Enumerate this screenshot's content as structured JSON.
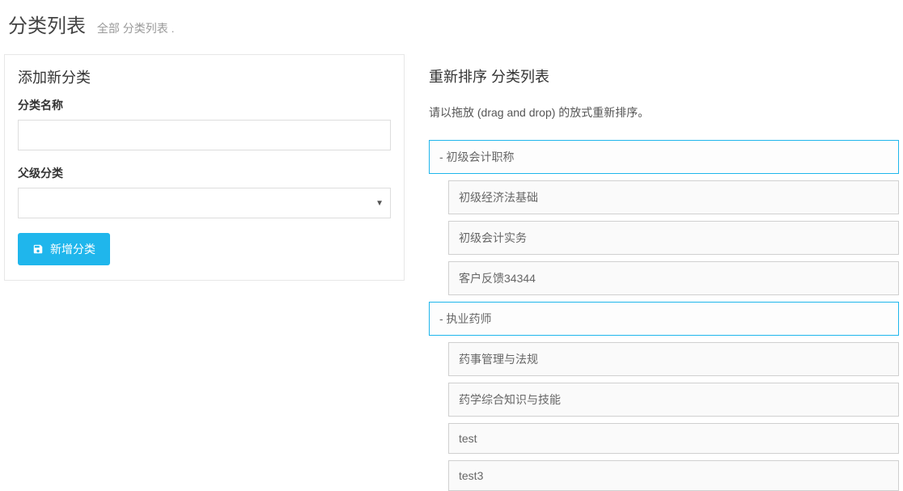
{
  "header": {
    "title": "分类列表",
    "subtitle": "全部 分类列表 ."
  },
  "form": {
    "panel_title": "添加新分类",
    "name_label": "分类名称",
    "name_value": "",
    "parent_label": "父级分类",
    "parent_value": "",
    "submit_label": "新增分类"
  },
  "reorder": {
    "title": "重新排序 分类列表",
    "hint": "请以拖放 (drag and drop) 的放式重新排序。",
    "items": [
      {
        "level": 0,
        "label": "-  初级会计职称"
      },
      {
        "level": 1,
        "label": "初级经济法基础"
      },
      {
        "level": 1,
        "label": "初级会计实务"
      },
      {
        "level": 1,
        "label": "客户反馈34344"
      },
      {
        "level": 0,
        "label": "-  执业药师"
      },
      {
        "level": 1,
        "label": "药事管理与法规"
      },
      {
        "level": 1,
        "label": "药学综合知识与技能"
      },
      {
        "level": 1,
        "label": "test"
      },
      {
        "level": 1,
        "label": "test3"
      }
    ]
  }
}
